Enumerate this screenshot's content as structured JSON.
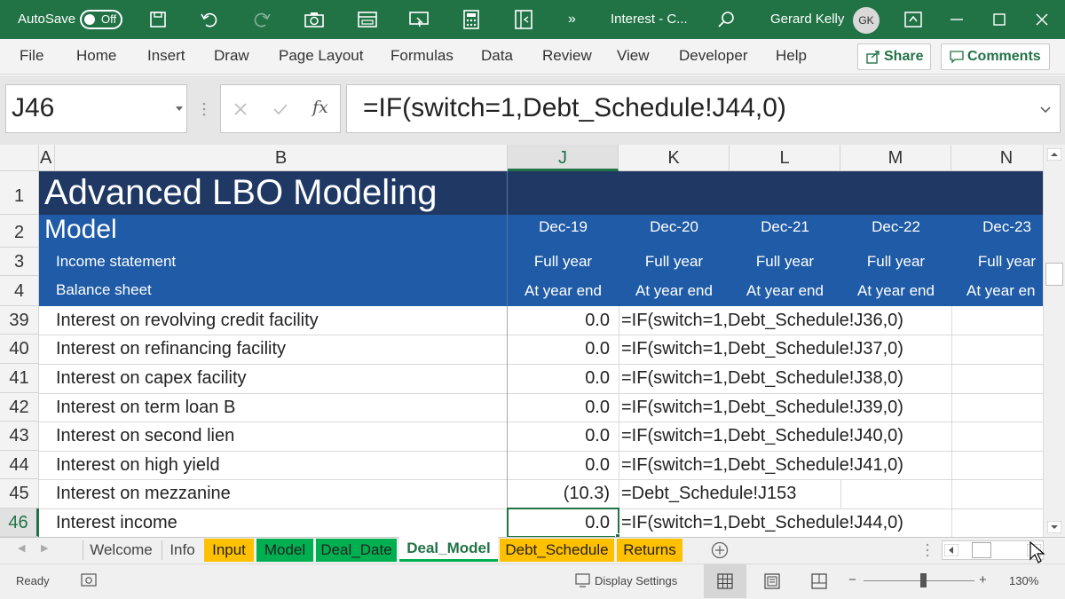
{
  "titlebar": {
    "autosave_label": "AutoSave",
    "autosave_state": "Off",
    "doc_title": "Interest - C...",
    "user_name": "Gerard Kelly",
    "user_initials": "GK",
    "more_glyph": "»"
  },
  "ribbon": {
    "tabs": [
      "File",
      "Home",
      "Insert",
      "Draw",
      "Page Layout",
      "Formulas",
      "Data",
      "Review",
      "View",
      "Developer",
      "Help"
    ],
    "share_label": "Share",
    "comments_label": "Comments"
  },
  "formula_bar": {
    "name_box": "J46",
    "formula": "=IF(switch=1,Debt_Schedule!J44,0)"
  },
  "columns": [
    "A",
    "B",
    "J",
    "K",
    "L",
    "M",
    "N"
  ],
  "header_rows": {
    "title": "Advanced LBO Modeling",
    "subtitle": "Model",
    "income_label": "Income statement",
    "balance_label": "Balance sheet",
    "periods": [
      "Dec-19",
      "Dec-20",
      "Dec-21",
      "Dec-22",
      "Dec-23"
    ],
    "income_period": "Full year",
    "balance_period": "At year end",
    "balance_period_cut": "At year en"
  },
  "row_numbers": [
    "1",
    "2",
    "3",
    "4",
    "39",
    "40",
    "41",
    "42",
    "43",
    "44",
    "45",
    "46"
  ],
  "rows": [
    {
      "label": "Interest on revolving credit facility",
      "j": "0.0",
      "k": "=IF(switch=1,Debt_Schedule!J36,0)"
    },
    {
      "label": "Interest on refinancing facility",
      "j": "0.0",
      "k": "=IF(switch=1,Debt_Schedule!J37,0)"
    },
    {
      "label": "Interest on capex facility",
      "j": "0.0",
      "k": "=IF(switch=1,Debt_Schedule!J38,0)"
    },
    {
      "label": "Interest on term loan B",
      "j": "0.0",
      "k": "=IF(switch=1,Debt_Schedule!J39,0)"
    },
    {
      "label": "Interest on second lien",
      "j": "0.0",
      "k": "=IF(switch=1,Debt_Schedule!J40,0)"
    },
    {
      "label": "Interest on high yield",
      "j": "0.0",
      "k": "=IF(switch=1,Debt_Schedule!J41,0)"
    },
    {
      "label": "Interest on mezzanine",
      "j": "(10.3)",
      "k": "=Debt_Schedule!J153"
    },
    {
      "label": "Interest income",
      "j": "0.0",
      "k": "=IF(switch=1,Debt_Schedule!J44,0)"
    }
  ],
  "sheets": [
    {
      "name": "Welcome",
      "color": "#f0f0f0"
    },
    {
      "name": "Info",
      "color": "#f0f0f0"
    },
    {
      "name": "Input",
      "color": "#ffc000"
    },
    {
      "name": "Model",
      "color": "#00b050"
    },
    {
      "name": "Deal_Date",
      "color": "#00b050"
    },
    {
      "name": "Deal_Model",
      "color": "#ffffff"
    },
    {
      "name": "Debt_Schedule",
      "color": "#ffc000"
    },
    {
      "name": "Returns",
      "color": "#ffc000"
    }
  ],
  "statusbar": {
    "ready": "Ready",
    "display_settings": "Display Settings",
    "zoom_minus": "−",
    "zoom_plus": "+",
    "zoom": "130%"
  },
  "colors": {
    "excel_green": "#217346",
    "navy_header": "#1f3864",
    "blue_header": "#1f5ba6"
  }
}
